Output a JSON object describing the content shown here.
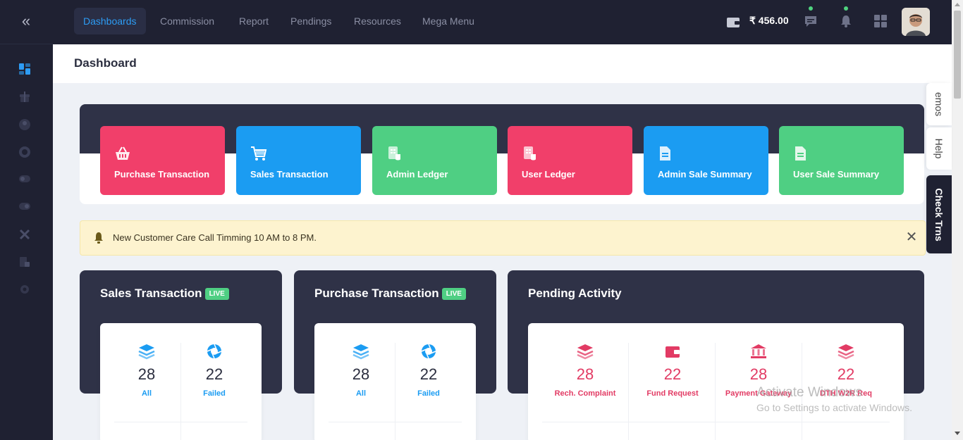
{
  "nav": {
    "items": [
      "Dashboards",
      "Commission",
      "Report",
      "Pendings",
      "Resources",
      "Mega Menu"
    ],
    "balance": "₹ 456.00"
  },
  "page": {
    "title": "Dashboard"
  },
  "quick_links": [
    {
      "label": "Purchase Transaction",
      "color": "#f13f6a",
      "icon": "basket-icon"
    },
    {
      "label": "Sales Transaction",
      "color": "#1b9cf2",
      "icon": "cart-icon"
    },
    {
      "label": "Admin Ledger",
      "color": "#4fcf83",
      "icon": "ledger-icon"
    },
    {
      "label": "User Ledger",
      "color": "#f13f6a",
      "icon": "ledger-icon"
    },
    {
      "label": "Admin Sale Summary",
      "color": "#1b9cf2",
      "icon": "document-icon"
    },
    {
      "label": "User Sale Summary",
      "color": "#4fcf83",
      "icon": "document-icon"
    }
  ],
  "side_tabs": [
    "emos",
    "Help",
    "Check Trns"
  ],
  "alert": {
    "message": "New Customer Care Call Timming 10 AM to 8 PM."
  },
  "cards": {
    "sales": {
      "title": "Sales Transaction",
      "badge": "LIVE",
      "stats": [
        {
          "value": "28",
          "label": "All"
        },
        {
          "value": "22",
          "label": "Failed"
        }
      ]
    },
    "purchase": {
      "title": "Purchase Transaction",
      "badge": "LIVE",
      "stats": [
        {
          "value": "28",
          "label": "All"
        },
        {
          "value": "22",
          "label": "Failed"
        }
      ]
    },
    "pending": {
      "title": "Pending Activity",
      "stats": [
        {
          "value": "28",
          "label": "Rech. Complaint"
        },
        {
          "value": "22",
          "label": "Fund Request"
        },
        {
          "value": "28",
          "label": "Payment Gateway"
        },
        {
          "value": "22",
          "label": "DTH W2R Req"
        }
      ]
    }
  },
  "watermark": {
    "line1": "Activate Windows",
    "line2": "Go to Settings to activate Windows."
  },
  "colors": {
    "accent": "#1b9cf2",
    "pink": "#f13f6a",
    "green": "#4fcf83",
    "dark": "#1f2132",
    "panel": "#2f3247"
  }
}
